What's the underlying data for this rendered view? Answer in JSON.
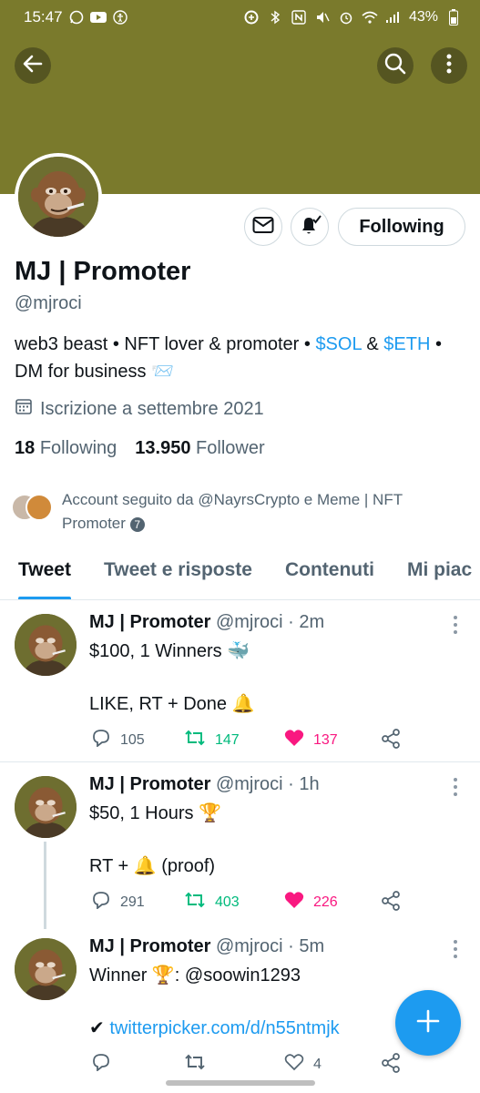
{
  "status_bar": {
    "time": "15:47",
    "battery": "43%",
    "left_icons": [
      "whatsapp-icon",
      "youtube-icon",
      "accessibility-icon"
    ],
    "right_icons": [
      "data-saver-icon",
      "bluetooth-icon",
      "nfc-icon",
      "mute-icon",
      "alarm-icon",
      "wifi-icon",
      "signal-icon",
      "battery-icon"
    ]
  },
  "header": {
    "back_icon": "arrow-left-icon",
    "search_icon": "search-icon",
    "more_icon": "more-vertical-icon",
    "banner_color": "#7a7a2c"
  },
  "profile": {
    "name": "MJ | Promoter",
    "handle": "@mjroci",
    "bio_parts": {
      "p1": "web3 beast • NFT lover & promoter • ",
      "sol": "$SOL",
      "p2": " & ",
      "eth": "$ETH",
      "p3": " • DM for business ",
      "emoji": "📨"
    },
    "joined": "Iscrizione a settembre 2021",
    "following_count": "18",
    "following_label": "Following",
    "followers_count": "13.950",
    "followers_label": "Follower",
    "followed_by": "Account seguito da @NayrsCrypto e Meme | NFT Promoter",
    "followed_by_badge": "7",
    "buttons": {
      "message_icon": "envelope-icon",
      "notify_icon": "bell-check-icon",
      "following_label": "Following"
    }
  },
  "tabs": [
    {
      "label": "Tweet",
      "active": true
    },
    {
      "label": "Tweet e risposte",
      "active": false
    },
    {
      "label": "Contenuti",
      "active": false
    },
    {
      "label": "Mi piac",
      "active": false
    }
  ],
  "tweets": [
    {
      "name": "MJ | Promoter",
      "handle": "@mjroci",
      "time": "· 2m",
      "line1": "$100, 1 Winners 🐳",
      "line2": "LIKE, RT + Done 🔔",
      "replies": "105",
      "retweets": "147",
      "likes": "137"
    },
    {
      "name": "MJ | Promoter",
      "handle": "@mjroci",
      "time": "· 1h",
      "line1": "$50, 1 Hours 🏆",
      "line2": "RT + 🔔 (proof)",
      "replies": "291",
      "retweets": "403",
      "likes": "226"
    },
    {
      "name": "MJ | Promoter",
      "handle": "@mjroci",
      "time": "· 5m",
      "line1": "Winner 🏆: @soowin1293",
      "check": "✔",
      "link": "twitterpicker.com/d/n55ntmjk",
      "replies": "",
      "retweets": "",
      "likes": "4"
    }
  ],
  "fab_icon": "plus-icon",
  "colors": {
    "accent": "#1d9bf0",
    "retweet": "#00ba7c",
    "like": "#f91880",
    "muted": "#536471"
  }
}
